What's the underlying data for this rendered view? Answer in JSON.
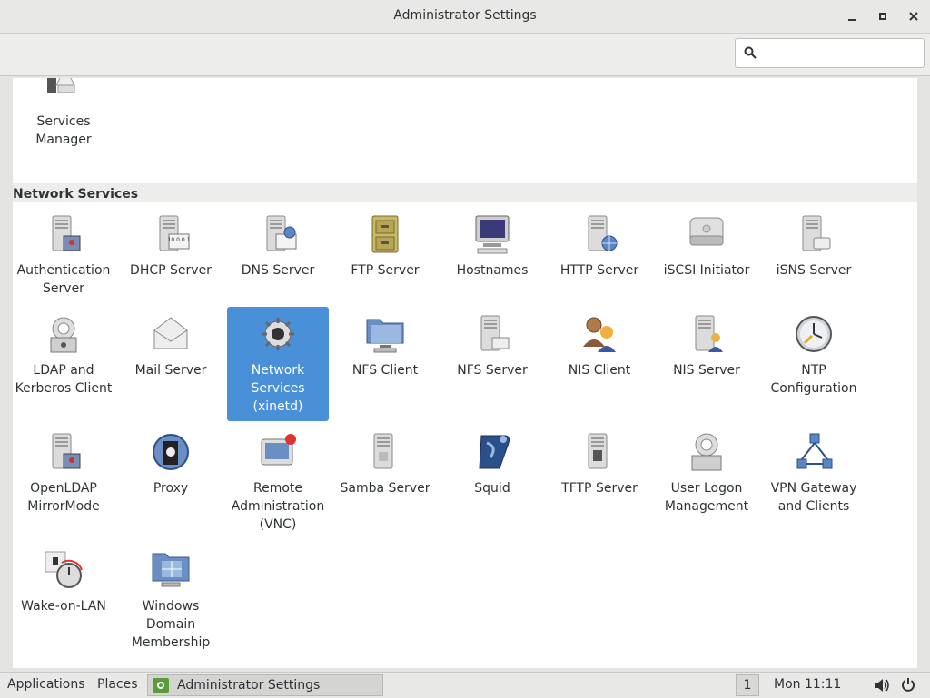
{
  "window": {
    "title": "Administrator Settings",
    "controls": [
      "minimize-icon",
      "maximize-icon",
      "close-icon"
    ]
  },
  "search": {
    "value": "",
    "placeholder": "",
    "icon": "search-icon"
  },
  "top_group": {
    "items": [
      {
        "label": "Services Manager",
        "icon": "services-manager-icon"
      }
    ]
  },
  "network_group": {
    "title": "Network Services",
    "items": [
      {
        "label": "Authentication Server",
        "icon": "authentication-server-icon"
      },
      {
        "label": "DHCP Server",
        "icon": "dhcp-server-icon"
      },
      {
        "label": "DNS Server",
        "icon": "dns-server-icon"
      },
      {
        "label": "FTP Server",
        "icon": "ftp-server-icon"
      },
      {
        "label": "Hostnames",
        "icon": "hostnames-icon"
      },
      {
        "label": "HTTP Server",
        "icon": "http-server-icon"
      },
      {
        "label": "iSCSI Initiator",
        "icon": "iscsi-initiator-icon"
      },
      {
        "label": "iSNS Server",
        "icon": "isns-server-icon"
      },
      {
        "label": "LDAP and Kerberos Client",
        "icon": "ldap-kerberos-icon"
      },
      {
        "label": "Mail Server",
        "icon": "mail-server-icon"
      },
      {
        "label": "Network Services (xinetd)",
        "icon": "xinetd-icon",
        "selected": true
      },
      {
        "label": "NFS Client",
        "icon": "nfs-client-icon"
      },
      {
        "label": "NFS Server",
        "icon": "nfs-server-icon"
      },
      {
        "label": "NIS Client",
        "icon": "nis-client-icon"
      },
      {
        "label": "NIS Server",
        "icon": "nis-server-icon"
      },
      {
        "label": "NTP Configuration",
        "icon": "ntp-configuration-icon"
      },
      {
        "label": "OpenLDAP MirrorMode",
        "icon": "openldap-mirrormode-icon"
      },
      {
        "label": "Proxy",
        "icon": "proxy-icon"
      },
      {
        "label": "Remote Administration (VNC)",
        "icon": "remote-administration-icon"
      },
      {
        "label": "Samba Server",
        "icon": "samba-server-icon"
      },
      {
        "label": "Squid",
        "icon": "squid-icon"
      },
      {
        "label": "TFTP Server",
        "icon": "tftp-server-icon"
      },
      {
        "label": "User Logon Management",
        "icon": "user-logon-icon"
      },
      {
        "label": "VPN Gateway and Clients",
        "icon": "vpn-gateway-icon"
      },
      {
        "label": "Wake-on-LAN",
        "icon": "wake-on-lan-icon"
      },
      {
        "label": "Windows Domain Membership",
        "icon": "windows-domain-icon"
      }
    ]
  },
  "taskbar": {
    "applications": "Applications",
    "places": "Places",
    "window_label": "Administrator Settings",
    "workspace": "1",
    "clock": "Mon 11:11",
    "volume_icon": "volume-icon",
    "power_icon": "power-icon"
  },
  "colors": {
    "selection": "#4a90d9",
    "titlebar": "#e8e8e7",
    "group_header": "#ededec"
  }
}
